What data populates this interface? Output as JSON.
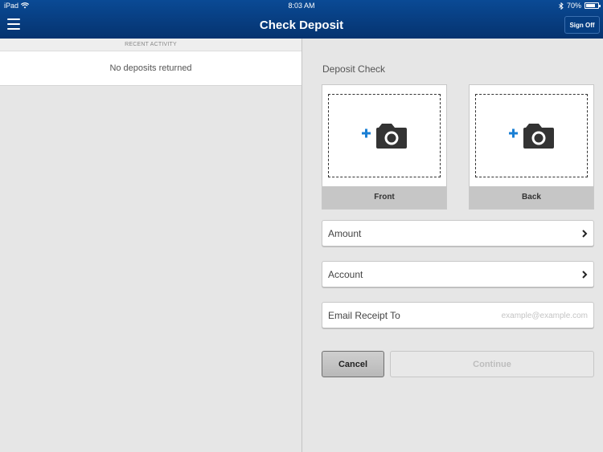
{
  "status_bar": {
    "device": "iPad",
    "time": "8:03 AM",
    "battery": "70%",
    "battery_level": 0.7
  },
  "nav": {
    "title": "Check Deposit",
    "sign_off_label": "Sign Off"
  },
  "recent_activity": {
    "header": "RECENT ACTIVITY",
    "empty_message": "No deposits returned"
  },
  "deposit": {
    "section_title": "Deposit Check",
    "front_label": "Front",
    "back_label": "Back",
    "amount_label": "Amount",
    "account_label": "Account",
    "email_label": "Email Receipt To",
    "email_placeholder": "example@example.com",
    "cancel_label": "Cancel",
    "continue_label": "Continue"
  },
  "colors": {
    "nav_blue": "#05336f",
    "plus_blue": "#1a7fd4"
  }
}
